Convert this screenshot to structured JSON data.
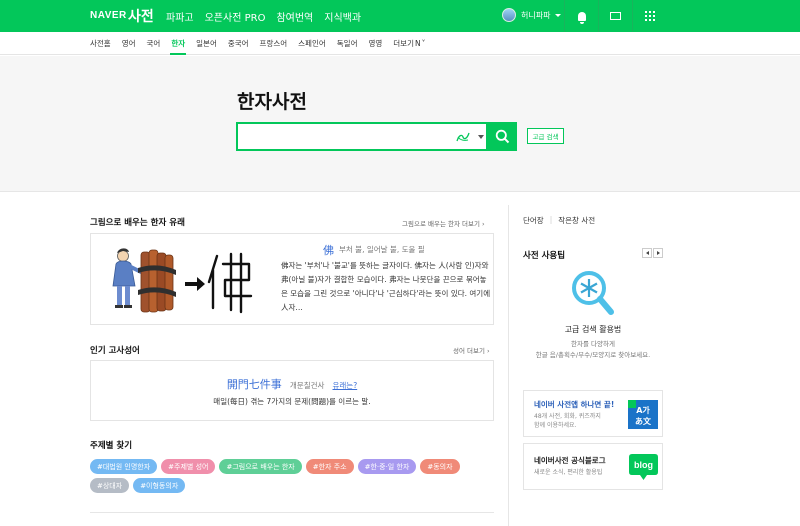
{
  "header": {
    "brand": "NAVER",
    "service": "사전",
    "nav": [
      "파파고",
      "오픈사전 PRO",
      "참여번역",
      "지식백과"
    ],
    "user_name": "허니파파",
    "icons": [
      "bell-icon",
      "mail-icon",
      "apps-grid-icon"
    ]
  },
  "subnav": {
    "items": [
      "사전홈",
      "영어",
      "국어",
      "한자",
      "일본어",
      "중국어",
      "프랑스어",
      "스페인어",
      "독일어",
      "영영",
      "더보기"
    ],
    "active": "한자",
    "new_badge": "N"
  },
  "hero": {
    "title": "한자사전",
    "search": {
      "value": "",
      "placeholder": ""
    },
    "advanced_search": "고급 검색"
  },
  "picture_origin": {
    "title": "그림으로 배우는 한자 유래",
    "more": "그림으로 배우는 한자 더보기 ›",
    "hanja": "佛",
    "meaning": "부처 불, 일어날 불, 도울 필",
    "description": "佛자는 '부처'나 '불교'를 뜻하는 글자이다. 佛자는 人(사람 인)자와 弗(아닐 불)자가 결합한 모습이다. 弗자는 나뭇단을 끈으로 묶어놓은 모습을 그린 것으로 '아니다'나 '근심하다'라는 뜻이 있다. 여기에 人자…",
    "ancient_char": "弗"
  },
  "idioms": {
    "title": "인기 고사성어",
    "more": "성어 더보기 ›",
    "hanja": "開門七件事",
    "reading": "개문칠건사",
    "what": "유래는?",
    "meaning": "매일(每日) 겪는 7가지의 문제(問題)를 이르는 말."
  },
  "topics": {
    "title": "주제별 찾기",
    "tags": [
      {
        "label": "#대법원 인명한자",
        "color": "#74b9f3"
      },
      {
        "label": "#주제별 성어",
        "color": "#f08fab"
      },
      {
        "label": "#그림으로 배우는 한자",
        "color": "#5fcf97"
      },
      {
        "label": "#한자 주소",
        "color": "#f08a78"
      },
      {
        "label": "#한·중·일 한자",
        "color": "#a89af0"
      },
      {
        "label": "#동의자",
        "color": "#f08a78"
      },
      {
        "label": "#상대자",
        "color": "#b5bcc6"
      },
      {
        "label": "#이형동의자",
        "color": "#74b9f3"
      }
    ]
  },
  "sidebar": {
    "tabs": [
      "단어장",
      "작은창 사전"
    ],
    "usage_title": "사전 사용팁",
    "tip_title": "고급 검색 활용법",
    "tip_desc_1": "한자를 다양하게",
    "tip_desc_2": "한글 음/총획수/부수/모양지로 찾아보세요.",
    "promos": [
      {
        "title": "네이버 사전앱 하나면 끝!",
        "desc_1": "48개 사전, 회화, 퀴즈까지",
        "desc_2": "함께 이용하세요.",
        "badge": "A가\n本文",
        "badge_color": "#1a73c8"
      },
      {
        "title": "네이버사전 공식블로그",
        "desc_1": "새로운 소식, 편리한 활용팁",
        "desc_2": "",
        "badge": "blog",
        "badge_color": "#03c75a"
      }
    ]
  }
}
